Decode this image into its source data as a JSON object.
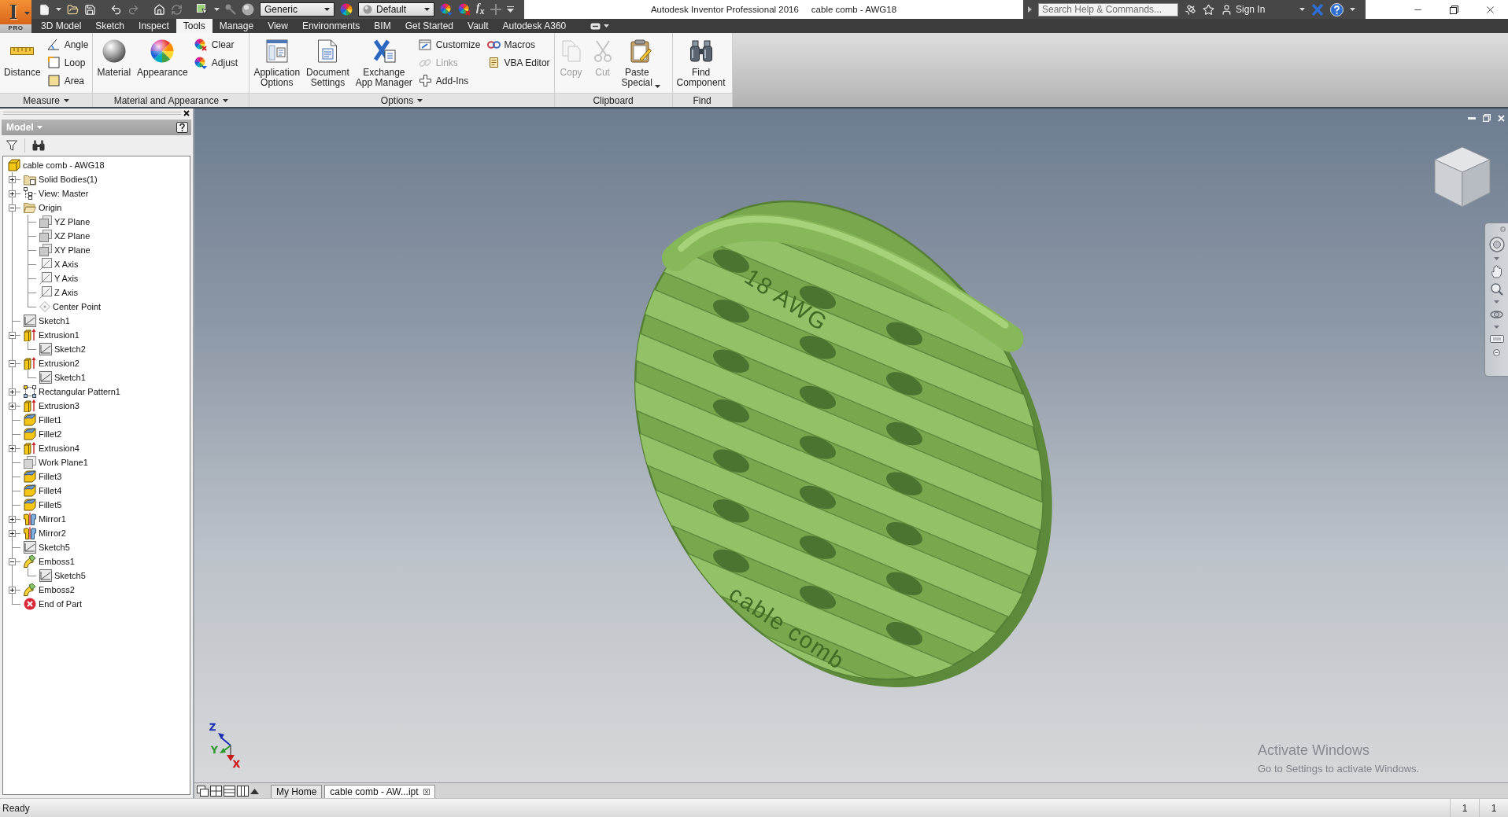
{
  "app_button": {
    "letter": "I",
    "edition": "PRO"
  },
  "quick_access": {
    "material": "Generic",
    "appearance": "Default",
    "parameters": "f$_{x}$"
  },
  "window": {
    "title": "Autodesk Inventor Professional 2016",
    "document": "cable comb - AWG18"
  },
  "help_search": {
    "placeholder": "Search Help & Commands..."
  },
  "account": {
    "label": "Sign In"
  },
  "ribbon_tabs": [
    {
      "label": "3D Model",
      "selected": false
    },
    {
      "label": "Sketch",
      "selected": false
    },
    {
      "label": "Inspect",
      "selected": false
    },
    {
      "label": "Tools",
      "selected": true
    },
    {
      "label": "Manage",
      "selected": false
    },
    {
      "label": "View",
      "selected": false
    },
    {
      "label": "Environments",
      "selected": false
    },
    {
      "label": "BIM",
      "selected": false
    },
    {
      "label": "Get Started",
      "selected": false
    },
    {
      "label": "Vault",
      "selected": false
    },
    {
      "label": "Autodesk A360",
      "selected": false
    }
  ],
  "ribbon_panels": [
    {
      "title": "Measure",
      "menu": true,
      "groups": [
        {
          "kind": "large",
          "tools": [
            {
              "label": "Distance",
              "disabled": false,
              "menu": false
            }
          ]
        },
        {
          "kind": "stack",
          "tools": [
            {
              "label": "Angle",
              "disabled": false,
              "menu": false
            },
            {
              "label": "Loop",
              "disabled": false,
              "menu": false
            },
            {
              "label": "Area",
              "disabled": false,
              "menu": false
            }
          ]
        }
      ]
    },
    {
      "title": "Material and Appearance",
      "menu": true,
      "groups": [
        {
          "kind": "large",
          "tools": [
            {
              "label": "Material",
              "disabled": false,
              "menu": false
            },
            {
              "label": "Appearance",
              "disabled": false,
              "menu": false
            }
          ]
        },
        {
          "kind": "stack",
          "tools": [
            {
              "label": "Clear",
              "disabled": false,
              "menu": false
            },
            {
              "label": "Adjust",
              "disabled": false,
              "menu": false
            }
          ]
        }
      ]
    },
    {
      "title": "Options",
      "menu": true,
      "groups": [
        {
          "kind": "large",
          "tools": [
            {
              "label": "Application\nOptions",
              "disabled": false,
              "menu": false
            },
            {
              "label": "Document\nSettings",
              "disabled": false,
              "menu": false
            },
            {
              "label": "Exchange\nApp Manager",
              "disabled": false,
              "menu": false
            }
          ]
        },
        {
          "kind": "stack",
          "tools": [
            {
              "label": "Customize",
              "disabled": false,
              "menu": false
            },
            {
              "label": "Links",
              "disabled": true,
              "menu": false
            },
            {
              "label": "Add-Ins",
              "disabled": false,
              "menu": false
            }
          ]
        },
        {
          "kind": "stack",
          "tools": [
            {
              "label": "Macros",
              "disabled": false,
              "menu": false
            },
            {
              "label": "VBA Editor",
              "disabled": false,
              "menu": false
            }
          ]
        }
      ]
    },
    {
      "title": "Clipboard",
      "menu": false,
      "groups": [
        {
          "kind": "large",
          "tools": [
            {
              "label": "Copy",
              "disabled": true,
              "menu": false
            },
            {
              "label": "Cut",
              "disabled": true,
              "menu": false
            },
            {
              "label": "Paste\nSpecial",
              "disabled": false,
              "menu": true
            }
          ]
        }
      ]
    },
    {
      "title": "Find",
      "menu": false,
      "groups": [
        {
          "kind": "large",
          "tools": [
            {
              "label": "Find\nComponent",
              "disabled": false,
              "menu": false
            }
          ]
        }
      ]
    }
  ],
  "model_browser": {
    "title": "Model",
    "tree": {
      "label": "cable comb - AWG18",
      "kind": "part",
      "children": [
        {
          "label": "Solid Bodies(1)",
          "kind": "bodies",
          "expanded": false
        },
        {
          "label": "View: Master",
          "kind": "view",
          "expanded": false
        },
        {
          "label": "Origin",
          "kind": "folder",
          "expanded": true,
          "children": [
            {
              "label": "YZ Plane",
              "kind": "plane"
            },
            {
              "label": "XZ Plane",
              "kind": "plane"
            },
            {
              "label": "XY Plane",
              "kind": "plane"
            },
            {
              "label": "X Axis",
              "kind": "axis"
            },
            {
              "label": "Y Axis",
              "kind": "axis"
            },
            {
              "label": "Z Axis",
              "kind": "axis"
            },
            {
              "label": "Center Point",
              "kind": "point"
            }
          ]
        },
        {
          "label": "Sketch1",
          "kind": "sketch"
        },
        {
          "label": "Extrusion1",
          "kind": "extrusion",
          "expanded": true,
          "children": [
            {
              "label": "Sketch2",
              "kind": "sketch"
            }
          ]
        },
        {
          "label": "Extrusion2",
          "kind": "extrusion",
          "expanded": true,
          "children": [
            {
              "label": "Sketch1",
              "kind": "sketch"
            }
          ]
        },
        {
          "label": "Rectangular Pattern1",
          "kind": "pattern",
          "expanded": false
        },
        {
          "label": "Extrusion3",
          "kind": "extrusion",
          "expanded": false
        },
        {
          "label": "Fillet1",
          "kind": "fillet"
        },
        {
          "label": "Fillet2",
          "kind": "fillet"
        },
        {
          "label": "Extrusion4",
          "kind": "extrusion",
          "expanded": false
        },
        {
          "label": "Work Plane1",
          "kind": "workplane"
        },
        {
          "label": "Fillet3",
          "kind": "fillet"
        },
        {
          "label": "Fillet4",
          "kind": "fillet"
        },
        {
          "label": "Fillet5",
          "kind": "fillet"
        },
        {
          "label": "Mirror1",
          "kind": "mirror",
          "expanded": false
        },
        {
          "label": "Mirror2",
          "kind": "mirror",
          "expanded": false
        },
        {
          "label": "Sketch5",
          "kind": "sketch"
        },
        {
          "label": "Emboss1",
          "kind": "emboss",
          "expanded": true,
          "children": [
            {
              "label": "Sketch5",
              "kind": "sketch"
            }
          ]
        },
        {
          "label": "Emboss2",
          "kind": "emboss",
          "expanded": false
        },
        {
          "label": "End of Part",
          "kind": "end"
        }
      ]
    }
  },
  "viewport": {
    "model": {
      "emboss_texts": [
        "18 AWG",
        "cable comb"
      ]
    },
    "triad": [
      {
        "label": "Z",
        "color": "#1c2fb0"
      },
      {
        "label": "Y",
        "color": "#2f9a2f"
      },
      {
        "label": "X",
        "color": "#d01818"
      }
    ],
    "activation_notice": {
      "title": "Activate Windows",
      "message": "Go to Settings to activate Windows."
    }
  },
  "document_tabs": [
    {
      "label": "My Home",
      "selected": false
    },
    {
      "label": "cable comb - AW...ipt",
      "selected": true
    }
  ],
  "status_bar": {
    "message": "Ready",
    "fields": [
      "1",
      "1"
    ]
  }
}
